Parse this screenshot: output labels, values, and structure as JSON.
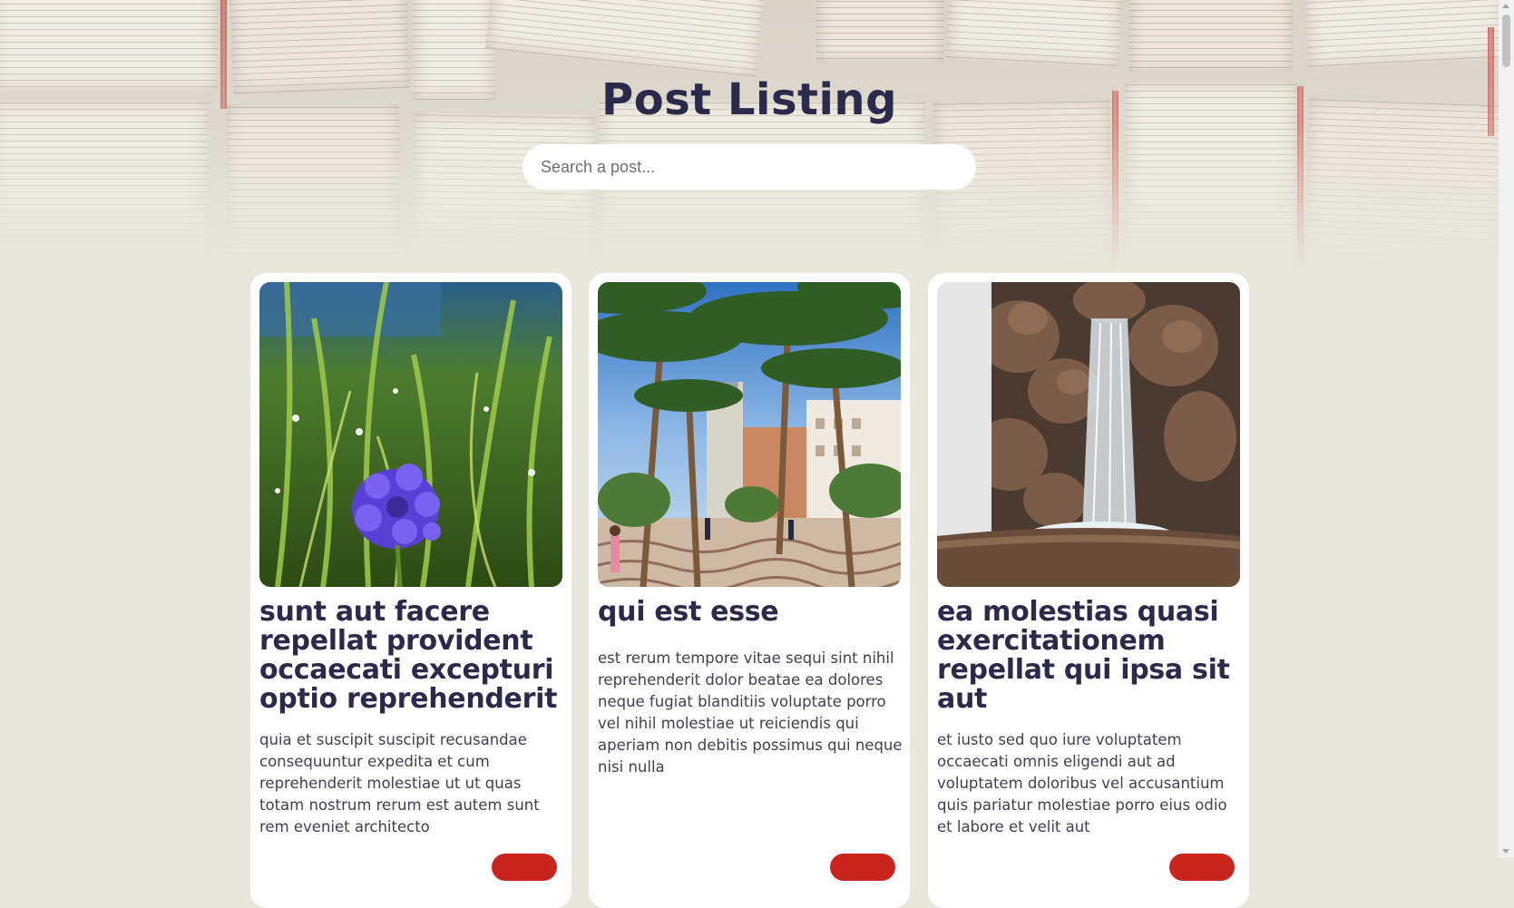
{
  "header": {
    "title": "Post Listing",
    "search_placeholder": "Search a post..."
  },
  "posts": [
    {
      "title": "sunt aut facere repellat provident occaecati excepturi optio reprehenderit",
      "body": "quia et suscipit suscipit recusandae consequuntur expedita et cum reprehenderit molestiae ut ut quas totam nostrum rerum est autem sunt rem eveniet architecto",
      "image": "blue-cornflower-photo"
    },
    {
      "title": "qui est esse",
      "body": "est rerum tempore vitae sequi sint nihil reprehenderit dolor beatae ea dolores neque fugiat blanditiis voluptate porro vel nihil molestiae ut reiciendis qui aperiam non debitis possimus qui neque nisi nulla",
      "image": "palm-promenade-photo"
    },
    {
      "title": "ea molestias quasi exercitationem repellat qui ipsa sit aut",
      "body": "et iusto sed quo iure voluptatem occaecati omnis eligendi aut ad voluptatem doloribus vel accusantium quis pariatur molestiae porro eius odio et labore et velit aut",
      "image": "rock-waterfall-fountain-photo"
    }
  ],
  "colors": {
    "page_background": "#e9e7dc",
    "title": "#2b2a4c",
    "card": "#ffffff",
    "button": "#c9251d"
  }
}
